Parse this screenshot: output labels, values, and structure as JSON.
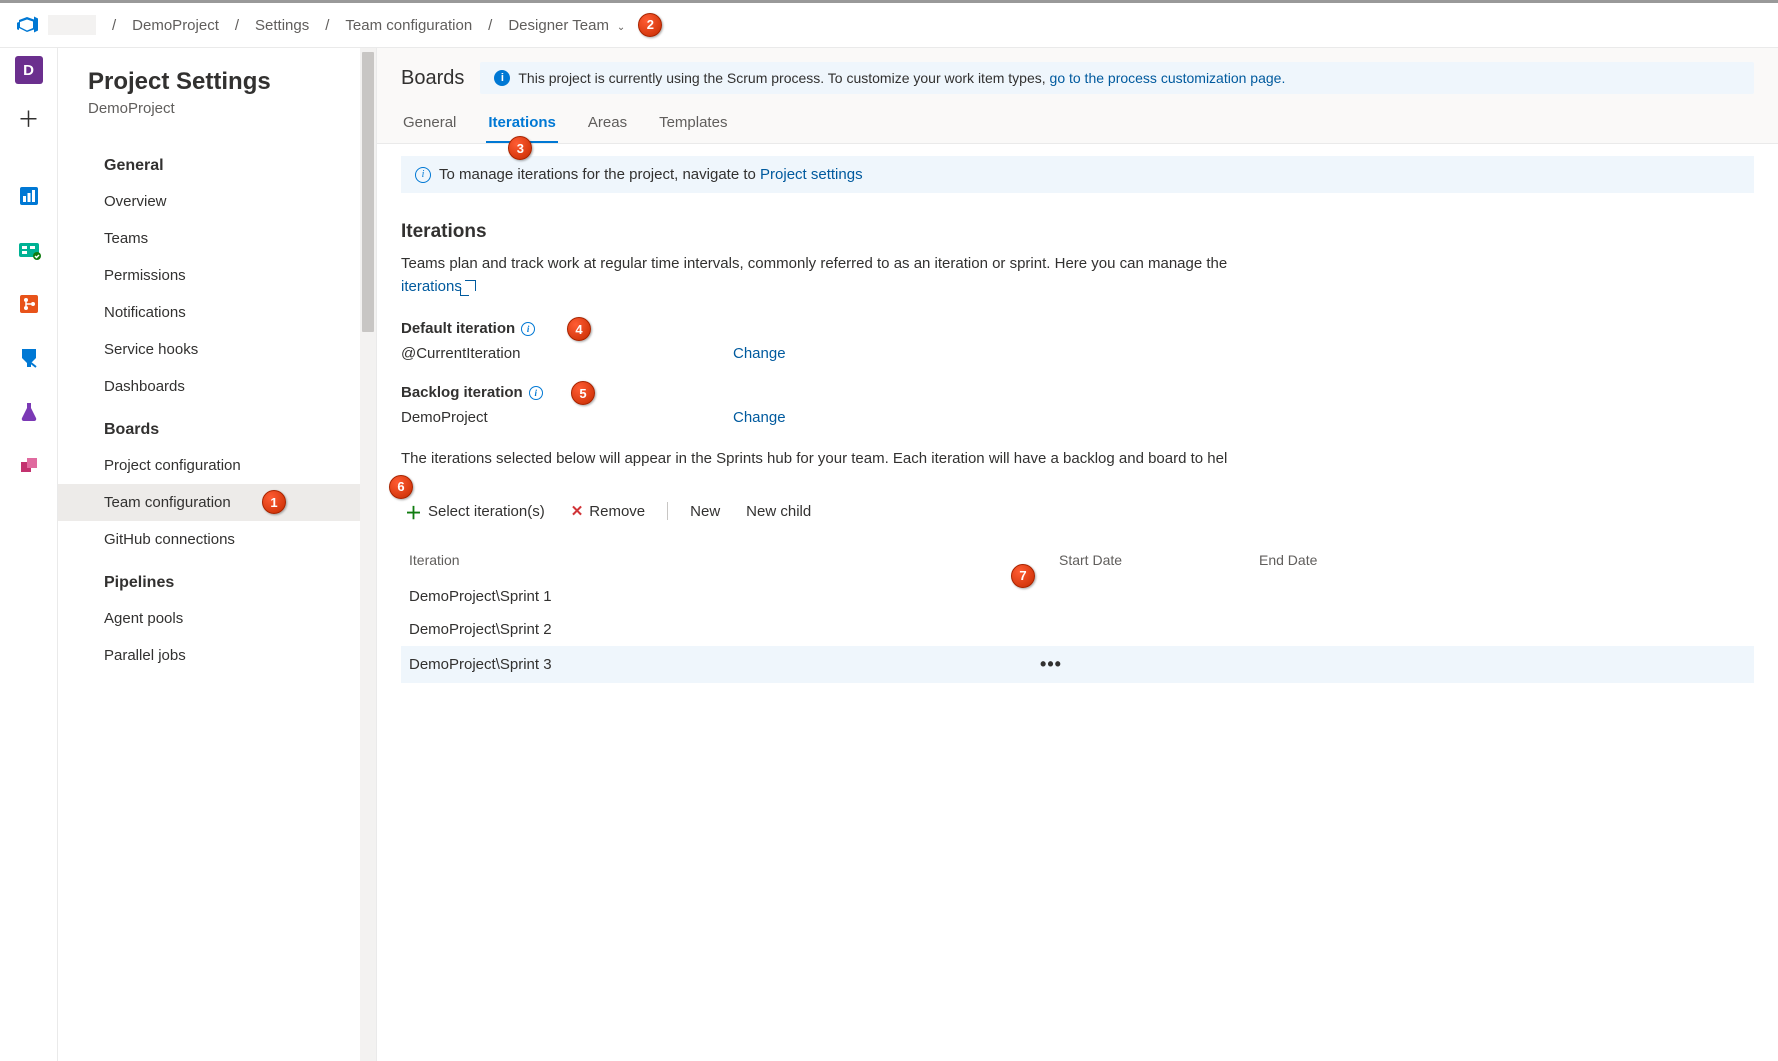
{
  "breadcrumb": {
    "project": "DemoProject",
    "settings": "Settings",
    "teamcfg": "Team configuration",
    "team": "Designer Team"
  },
  "iconbar_project_letter": "D",
  "sidebar": {
    "title": "Project Settings",
    "subtitle": "DemoProject",
    "groups": [
      {
        "heading": "General",
        "items": [
          "Overview",
          "Teams",
          "Permissions",
          "Notifications",
          "Service hooks",
          "Dashboards"
        ]
      },
      {
        "heading": "Boards",
        "items": [
          "Project configuration",
          "Team configuration",
          "GitHub connections"
        ],
        "selected": "Team configuration"
      },
      {
        "heading": "Pipelines",
        "items": [
          "Agent pools",
          "Parallel jobs"
        ]
      }
    ]
  },
  "main": {
    "boards_title": "Boards",
    "banner_text": "This project is currently using the Scrum process. To customize your work item types, ",
    "banner_link": "go to the process customization page.",
    "tabs": {
      "general": "General",
      "iterations": "Iterations",
      "areas": "Areas",
      "templates": "Templates"
    },
    "manage_msg_pre": "To manage iterations for the project, navigate to ",
    "manage_msg_link": "Project settings",
    "iter_heading": "Iterations",
    "iter_desc_pre": "Teams plan and track work at regular time intervals, commonly referred to as an iteration or sprint. Here you can manage the ",
    "iter_desc_link": "iterations",
    "default_iter_h": "Default iteration",
    "default_iter_val": "@CurrentIteration",
    "backlog_iter_h": "Backlog iteration",
    "backlog_iter_val": "DemoProject",
    "change": "Change",
    "sprints_desc": "The iterations selected below will appear in the Sprints hub for your team. Each iteration will have a backlog and board to hel",
    "toolbar": {
      "select": "Select iteration(s)",
      "remove": "Remove",
      "new": "New",
      "newchild": "New child"
    },
    "columns": {
      "iter": "Iteration",
      "start": "Start Date",
      "end": "End Date"
    },
    "rows": [
      {
        "name": "DemoProject\\Sprint 1",
        "sel": false
      },
      {
        "name": "DemoProject\\Sprint 2",
        "sel": false
      },
      {
        "name": "DemoProject\\Sprint 3",
        "sel": true
      }
    ]
  },
  "badges": {
    "b1": "1",
    "b2": "2",
    "b3": "3",
    "b4": "4",
    "b5": "5",
    "b6": "6",
    "b7": "7"
  }
}
